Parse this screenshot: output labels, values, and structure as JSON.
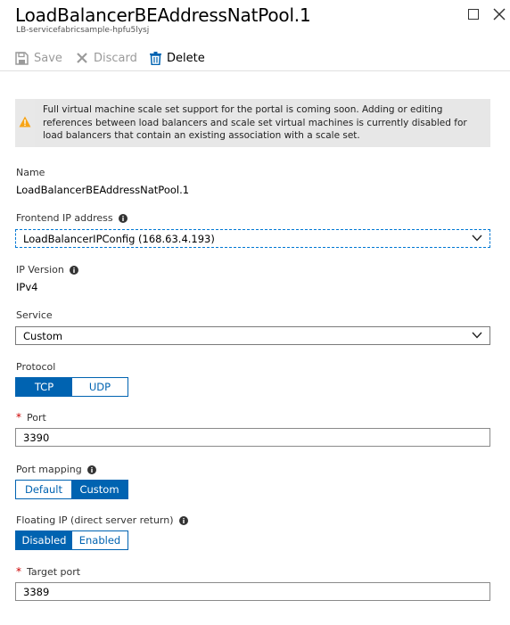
{
  "header": {
    "title": "LoadBalancerBEAddressNatPool.1",
    "subtitle": "LB-servicefabricsample-hpfu5lysj",
    "maximize_icon": "maximize-icon",
    "close_icon": "close-icon"
  },
  "toolbar": {
    "save_label": "Save",
    "discard_label": "Discard",
    "delete_label": "Delete"
  },
  "notice": {
    "text": "Full virtual machine scale set support for the portal is coming soon. Adding or editing references between load balancers and scale set virtual machines is currently disabled for load balancers that contain an existing association with a scale set.",
    "icon": "warning-icon"
  },
  "form": {
    "name_label": "Name",
    "name_value": "LoadBalancerBEAddressNatPool.1",
    "frontend_label": "Frontend IP address",
    "frontend_value": "LoadBalancerIPConfig (168.63.4.193)",
    "ipversion_label": "IP Version",
    "ipversion_value": "IPv4",
    "service_label": "Service",
    "service_value": "Custom",
    "protocol_label": "Protocol",
    "protocol_options": [
      "TCP",
      "UDP"
    ],
    "protocol_selected": "TCP",
    "port_required": "*",
    "port_label": "Port",
    "port_value": "3390",
    "portmapping_label": "Port mapping",
    "portmapping_options": [
      "Default",
      "Custom"
    ],
    "portmapping_selected": "Custom",
    "floating_label": "Floating IP (direct server return)",
    "floating_options": [
      "Disabled",
      "Enabled"
    ],
    "floating_selected": "Disabled",
    "target_required": "*",
    "target_label": "Target port",
    "target_value": "3389"
  },
  "colors": {
    "accent": "#0063b1",
    "warning": "#f7a416",
    "required": "#cc0000"
  }
}
